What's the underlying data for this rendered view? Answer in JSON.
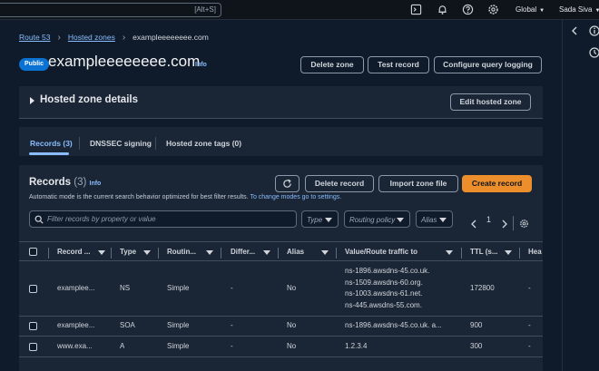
{
  "topbar": {
    "search_shortcut": "[Alt+S]",
    "region": "Global",
    "user": "Sada Siva"
  },
  "breadcrumb": {
    "items": [
      "Route 53",
      "Hosted zones",
      "exampleeeeeeee.com"
    ]
  },
  "header": {
    "badge": "Public",
    "title": "exampleeeeeeee.com",
    "info": "Info",
    "buttons": {
      "delete_zone": "Delete zone",
      "test_record": "Test record",
      "configure_query_logging": "Configure query logging"
    }
  },
  "hosted_zone_details": {
    "title": "Hosted zone details",
    "edit_button": "Edit hosted zone"
  },
  "tabs": [
    {
      "label": "Records (3)"
    },
    {
      "label": "DNSSEC signing"
    },
    {
      "label": "Hosted zone tags (0)"
    }
  ],
  "records": {
    "title": "Records",
    "count": "(3)",
    "info": "Info",
    "buttons": {
      "delete": "Delete record",
      "import": "Import zone file",
      "create": "Create record"
    },
    "description": "Automatic mode is the current search behavior optimized for best filter results.",
    "description_link": "To change modes go to settings.",
    "filter_placeholder": "Filter records by property or value",
    "filters": {
      "type": "Type",
      "routing_policy": "Routing policy",
      "alias": "Alias"
    },
    "page": "1",
    "columns": [
      "Record ...",
      "Type",
      "Routin...",
      "Differ...",
      "Alias",
      "Value/Route traffic to",
      "TTL (s...",
      "Hea"
    ],
    "rows": [
      {
        "name": "examplee...",
        "type": "NS",
        "routing": "Simple",
        "differ": "-",
        "alias": "No",
        "values": [
          "ns-1896.awsdns-45.co.uk.",
          "ns-1509.awsdns-60.org.",
          "ns-1003.awsdns-61.net.",
          "ns-445.awsdns-55.com."
        ],
        "ttl": "172800",
        "health": "-"
      },
      {
        "name": "examplee...",
        "type": "SOA",
        "routing": "Simple",
        "differ": "-",
        "alias": "No",
        "values": [
          "ns-1896.awsdns-45.co.uk. a..."
        ],
        "ttl": "900",
        "health": "-"
      },
      {
        "name": "www.exa...",
        "type": "A",
        "routing": "Simple",
        "differ": "-",
        "alias": "No",
        "values": [
          "1.2.3.4"
        ],
        "ttl": "300",
        "health": "-"
      }
    ]
  }
}
